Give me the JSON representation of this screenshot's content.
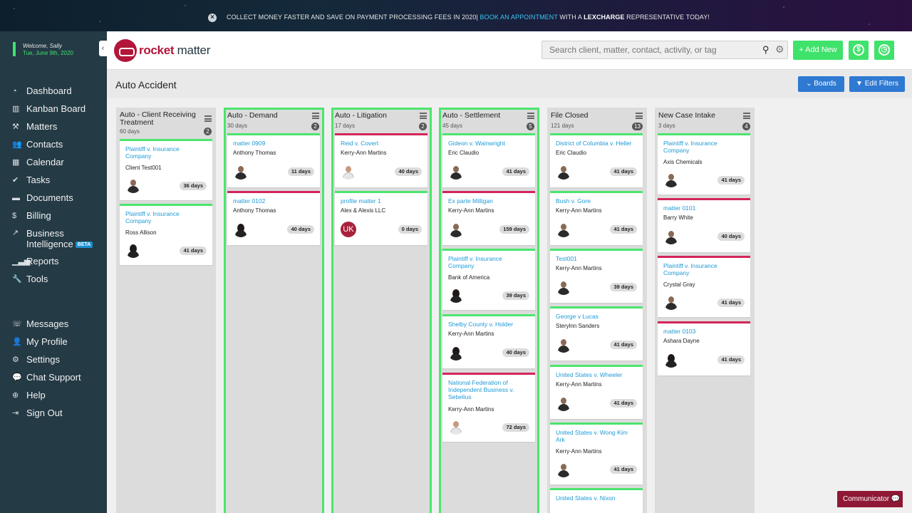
{
  "banner": {
    "text_pre": "COLLECT MONEY FASTER AND SAVE ON PAYMENT PROCESSING FEES IN 2020|",
    "link": "BOOK AN APPOINTMENT",
    "text_mid": "WITH A",
    "brand": "LEXCHARGE",
    "text_post": "REPRESENTATIVE TODAY!"
  },
  "user": {
    "welcome": "Welcome, Sally",
    "date": "Tue, June 9th, 2020"
  },
  "nav": {
    "dashboard": "Dashboard",
    "kanban": "Kanban Board",
    "matters": "Matters",
    "contacts": "Contacts",
    "calendar": "Calendar",
    "tasks": "Tasks",
    "documents": "Documents",
    "billing": "Billing",
    "bi_line1": "Business",
    "bi_line2": "Intelligence",
    "beta": "BETA",
    "reports": "Reports",
    "tools": "Tools",
    "messages": "Messages",
    "profile": "My Profile",
    "settings": "Settings",
    "chat": "Chat Support",
    "help": "Help",
    "signout": "Sign Out"
  },
  "brand": {
    "name_a": "rocket",
    "name_b": "matter"
  },
  "search": {
    "placeholder": "Search client, matter, contact, activity, or tag"
  },
  "header": {
    "add_new": "+ Add New"
  },
  "board": {
    "title": "Auto Accident",
    "boards_btn": "⌄ Boards",
    "filters_btn": "▼ Edit Filters"
  },
  "columns": [
    {
      "name": "Auto - Client Receiving Treatment",
      "days": "60 days",
      "count": "2",
      "cards": [
        {
          "title": "Plaintiff v. Insurance Company",
          "client": "Client Test001",
          "days": "36 days"
        },
        {
          "title": "Plaintiff v. Insurance Company",
          "client": "Ross Allison",
          "days": "41 days"
        }
      ]
    },
    {
      "name": "Auto - Demand",
      "days": "30 days",
      "count": "2",
      "cards": [
        {
          "title": "matter 0909",
          "client": "Anthony Thomas",
          "days": "11 days"
        },
        {
          "title": "matter 0102",
          "client": "Anthony Thomas",
          "days": "40 days"
        }
      ]
    },
    {
      "name": "Auto - Litigation",
      "days": "17 days",
      "count": "2",
      "cards": [
        {
          "title": "Reid v. Covert",
          "client": "Kerry-Ann Martins",
          "days": "40 days"
        },
        {
          "title": "profile matter 1",
          "client": "Alex & Alexis LLC",
          "days": "0 days",
          "initials": "UK"
        }
      ]
    },
    {
      "name": "Auto - Settlement",
      "days": "45 days",
      "count": "5",
      "cards": [
        {
          "title": "Gideon v. Wainwright",
          "client": "Eric Claudio",
          "days": "41 days"
        },
        {
          "title": "Ex parte Milligan",
          "client": "Kerry-Ann Martins",
          "days": "159 days"
        },
        {
          "title": "Plaintiff v. Insurance Company",
          "client": "Bank of America",
          "days": "39 days"
        },
        {
          "title": "Shelby County v. Holder",
          "client": "Kerry-Ann Martins",
          "days": "40 days"
        },
        {
          "title": "National Federation of Independent Business v. Sebelius",
          "client": "Kerry-Ann Martins",
          "days": "72 days"
        }
      ]
    },
    {
      "name": "File Closed",
      "days": "121 days",
      "count": "13",
      "cards": [
        {
          "title": "District of Columbia v. Heller",
          "client": "Eric Claudio",
          "days": "41 days"
        },
        {
          "title": "Bush v. Gore",
          "client": "Kerry-Ann Martins",
          "days": "41 days"
        },
        {
          "title": "Test001",
          "client": "Kerry-Ann Martins",
          "days": "39 days"
        },
        {
          "title": "George v Lucas",
          "client": "Sterylnn Sanders",
          "days": "41 days"
        },
        {
          "title": "United States v. Wheeler",
          "client": "Kerry-Ann Martins",
          "days": "41 days"
        },
        {
          "title": "United States v. Wong Kim Ark",
          "client": "Kerry-Ann Martins",
          "days": "41 days"
        },
        {
          "title": "United States v. Nixon",
          "client": "",
          "days": ""
        }
      ]
    },
    {
      "name": "New Case Intake",
      "days": "3 days",
      "count": "4",
      "cards": [
        {
          "title": "Plaintiff v. Insurance Company",
          "client": "Axis Chemicals",
          "days": "41 days"
        },
        {
          "title": "matter 0101",
          "client": "Barry White",
          "days": "40 days"
        },
        {
          "title": "Plaintiff v. Insurance Company",
          "client": "Crystal Gray",
          "days": "41 days"
        },
        {
          "title": "matter 0103",
          "client": "Ashara Dayne",
          "days": "41 days"
        }
      ]
    }
  ],
  "communicator": "Communicator",
  "colors": {
    "accent_green": "#4be56e",
    "brand_red": "#b3163a",
    "link_blue": "#1e9ad6",
    "button_blue": "#2e79d1"
  }
}
